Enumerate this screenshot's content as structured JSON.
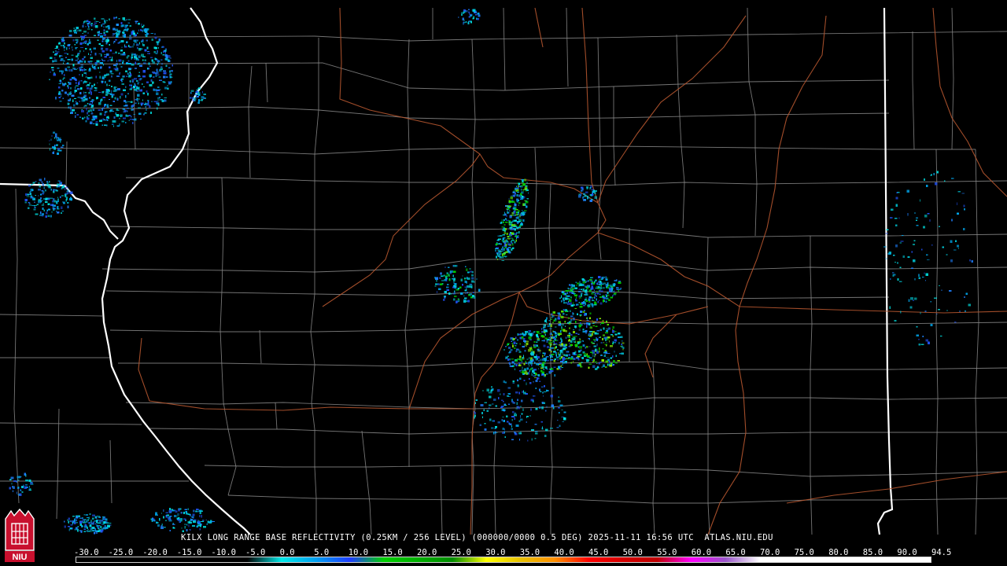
{
  "map": {
    "product_title": "KILX LONG RANGE BASE REFLECTIVITY (0.25KM / 256 LEVEL) (000000/0000 0.5 DEG) 2025-11-11 16:56 UTC  ATLAS.NIU.EDU",
    "radar_site": "KILX",
    "valid_time": "2025-11-11 16:56 UTC",
    "source": "ATLAS.NIU.EDU",
    "logo_text": "NIU"
  },
  "legend": {
    "labels": [
      "-30.0",
      "-25.0",
      "-20.0",
      "-15.0",
      "-10.0",
      "-5.0",
      "0.0",
      "5.0",
      "10.0",
      "15.0",
      "20.0",
      "25.0",
      "30.0",
      "35.0",
      "40.0",
      "45.0",
      "50.0",
      "55.0",
      "60.0",
      "65.0",
      "70.0",
      "75.0",
      "80.0",
      "85.0",
      "90.0",
      "94.5"
    ],
    "colors": [
      "#000000",
      "#000000",
      "#000000",
      "#000000",
      "#000000",
      "#000000",
      "#00e8e8",
      "#00a0f0",
      "#1e3cff",
      "#00d000",
      "#00b000",
      "#008c00",
      "#ffff00",
      "#e7c000",
      "#ff9000",
      "#ff0000",
      "#d60000",
      "#c00000",
      "#ff00ff",
      "#9955c9",
      "#ffffff",
      "#ffffff",
      "#ffffff",
      "#ffffff",
      "#ffffff"
    ]
  },
  "colors": {
    "background": "#000000",
    "state_border": "#ffffff",
    "county_border": "#8a8a8a",
    "highway": "#b4552f"
  }
}
